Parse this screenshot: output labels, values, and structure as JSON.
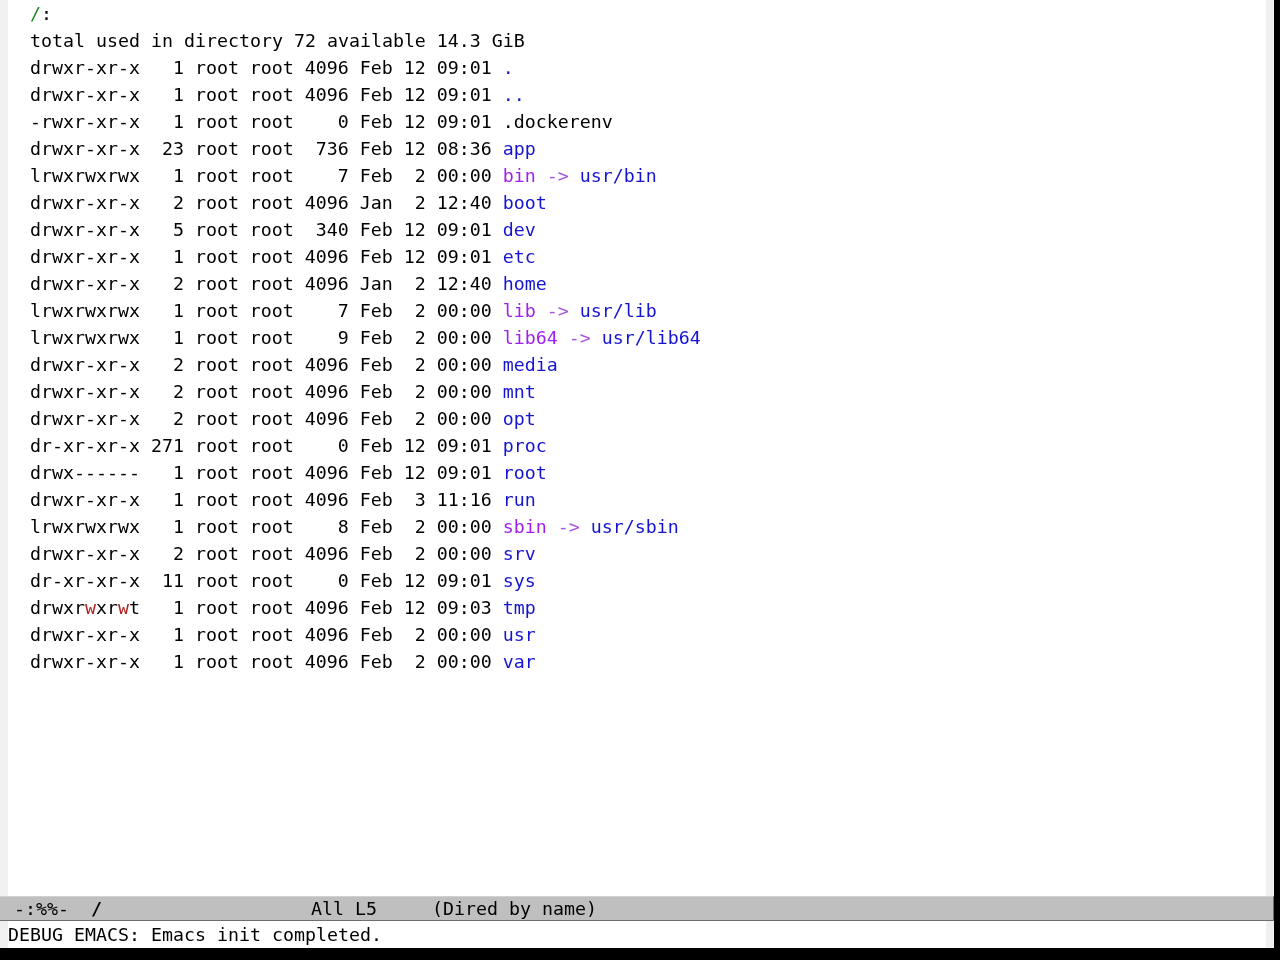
{
  "buffer": {
    "header": {
      "directory": "/",
      "colon": ":"
    },
    "summary": "total used in directory 72 available 14.3 GiB",
    "rows": [
      {
        "kind": "directory",
        "permissions": "drwxr-xr-x",
        "write_warning": false,
        "links": "1",
        "owner": "root",
        "group": "root",
        "size": "4096",
        "modified": "Feb 12 09:01",
        "name": "."
      },
      {
        "kind": "directory",
        "permissions": "drwxr-xr-x",
        "write_warning": false,
        "links": "1",
        "owner": "root",
        "group": "root",
        "size": "4096",
        "modified": "Feb 12 09:01",
        "name": ".."
      },
      {
        "kind": "file",
        "permissions": "-rwxr-xr-x",
        "write_warning": false,
        "links": "1",
        "owner": "root",
        "group": "root",
        "size": "0",
        "modified": "Feb 12 09:01",
        "name": ".dockerenv"
      },
      {
        "kind": "directory",
        "permissions": "drwxr-xr-x",
        "write_warning": false,
        "links": "23",
        "owner": "root",
        "group": "root",
        "size": "736",
        "modified": "Feb 12 08:36",
        "name": "app"
      },
      {
        "kind": "symlink",
        "permissions": "lrwxrwxrwx",
        "write_warning": false,
        "links": "1",
        "owner": "root",
        "group": "root",
        "size": "7",
        "modified": "Feb  2 00:00",
        "name": "bin",
        "arrow": "->",
        "target": "usr/bin"
      },
      {
        "kind": "directory",
        "permissions": "drwxr-xr-x",
        "write_warning": false,
        "links": "2",
        "owner": "root",
        "group": "root",
        "size": "4096",
        "modified": "Jan  2 12:40",
        "name": "boot"
      },
      {
        "kind": "directory",
        "permissions": "drwxr-xr-x",
        "write_warning": false,
        "links": "5",
        "owner": "root",
        "group": "root",
        "size": "340",
        "modified": "Feb 12 09:01",
        "name": "dev"
      },
      {
        "kind": "directory",
        "permissions": "drwxr-xr-x",
        "write_warning": false,
        "links": "1",
        "owner": "root",
        "group": "root",
        "size": "4096",
        "modified": "Feb 12 09:01",
        "name": "etc"
      },
      {
        "kind": "directory",
        "permissions": "drwxr-xr-x",
        "write_warning": false,
        "links": "2",
        "owner": "root",
        "group": "root",
        "size": "4096",
        "modified": "Jan  2 12:40",
        "name": "home"
      },
      {
        "kind": "symlink",
        "permissions": "lrwxrwxrwx",
        "write_warning": false,
        "links": "1",
        "owner": "root",
        "group": "root",
        "size": "7",
        "modified": "Feb  2 00:00",
        "name": "lib",
        "arrow": "->",
        "target": "usr/lib"
      },
      {
        "kind": "symlink",
        "permissions": "lrwxrwxrwx",
        "write_warning": false,
        "links": "1",
        "owner": "root",
        "group": "root",
        "size": "9",
        "modified": "Feb  2 00:00",
        "name": "lib64",
        "arrow": "->",
        "target": "usr/lib64"
      },
      {
        "kind": "directory",
        "permissions": "drwxr-xr-x",
        "write_warning": false,
        "links": "2",
        "owner": "root",
        "group": "root",
        "size": "4096",
        "modified": "Feb  2 00:00",
        "name": "media"
      },
      {
        "kind": "directory",
        "permissions": "drwxr-xr-x",
        "write_warning": false,
        "links": "2",
        "owner": "root",
        "group": "root",
        "size": "4096",
        "modified": "Feb  2 00:00",
        "name": "mnt"
      },
      {
        "kind": "directory",
        "permissions": "drwxr-xr-x",
        "write_warning": false,
        "links": "2",
        "owner": "root",
        "group": "root",
        "size": "4096",
        "modified": "Feb  2 00:00",
        "name": "opt"
      },
      {
        "kind": "directory",
        "permissions": "dr-xr-xr-x",
        "write_warning": false,
        "links": "271",
        "owner": "root",
        "group": "root",
        "size": "0",
        "modified": "Feb 12 09:01",
        "name": "proc"
      },
      {
        "kind": "directory",
        "permissions": "drwx------",
        "write_warning": false,
        "links": "1",
        "owner": "root",
        "group": "root",
        "size": "4096",
        "modified": "Feb 12 09:01",
        "name": "root"
      },
      {
        "kind": "directory",
        "permissions": "drwxr-xr-x",
        "write_warning": false,
        "links": "1",
        "owner": "root",
        "group": "root",
        "size": "4096",
        "modified": "Feb  3 11:16",
        "name": "run"
      },
      {
        "kind": "symlink",
        "permissions": "lrwxrwxrwx",
        "write_warning": false,
        "links": "1",
        "owner": "root",
        "group": "root",
        "size": "8",
        "modified": "Feb  2 00:00",
        "name": "sbin",
        "arrow": "->",
        "target": "usr/sbin"
      },
      {
        "kind": "directory",
        "permissions": "drwxr-xr-x",
        "write_warning": false,
        "links": "2",
        "owner": "root",
        "group": "root",
        "size": "4096",
        "modified": "Feb  2 00:00",
        "name": "srv"
      },
      {
        "kind": "directory",
        "permissions": "dr-xr-xr-x",
        "write_warning": false,
        "links": "11",
        "owner": "root",
        "group": "root",
        "size": "0",
        "modified": "Feb 12 09:01",
        "name": "sys"
      },
      {
        "kind": "directory",
        "permissions": "drwxrwxrwt",
        "write_warning": true,
        "links": "1",
        "owner": "root",
        "group": "root",
        "size": "4096",
        "modified": "Feb 12 09:03",
        "name": "tmp"
      },
      {
        "kind": "directory",
        "permissions": "drwxr-xr-x",
        "write_warning": false,
        "links": "1",
        "owner": "root",
        "group": "root",
        "size": "4096",
        "modified": "Feb  2 00:00",
        "name": "usr"
      },
      {
        "kind": "directory",
        "permissions": "drwxr-xr-x",
        "write_warning": false,
        "links": "1",
        "owner": "root",
        "group": "root",
        "size": "4096",
        "modified": "Feb  2 00:00",
        "name": "var"
      }
    ]
  },
  "mode_line": {
    "status": "-:%%-",
    "buffer_name": "/",
    "position": "All",
    "line": "L5",
    "mode": "(Dired by name)"
  },
  "echo_area": "DEBUG EMACS: Emacs init completed."
}
